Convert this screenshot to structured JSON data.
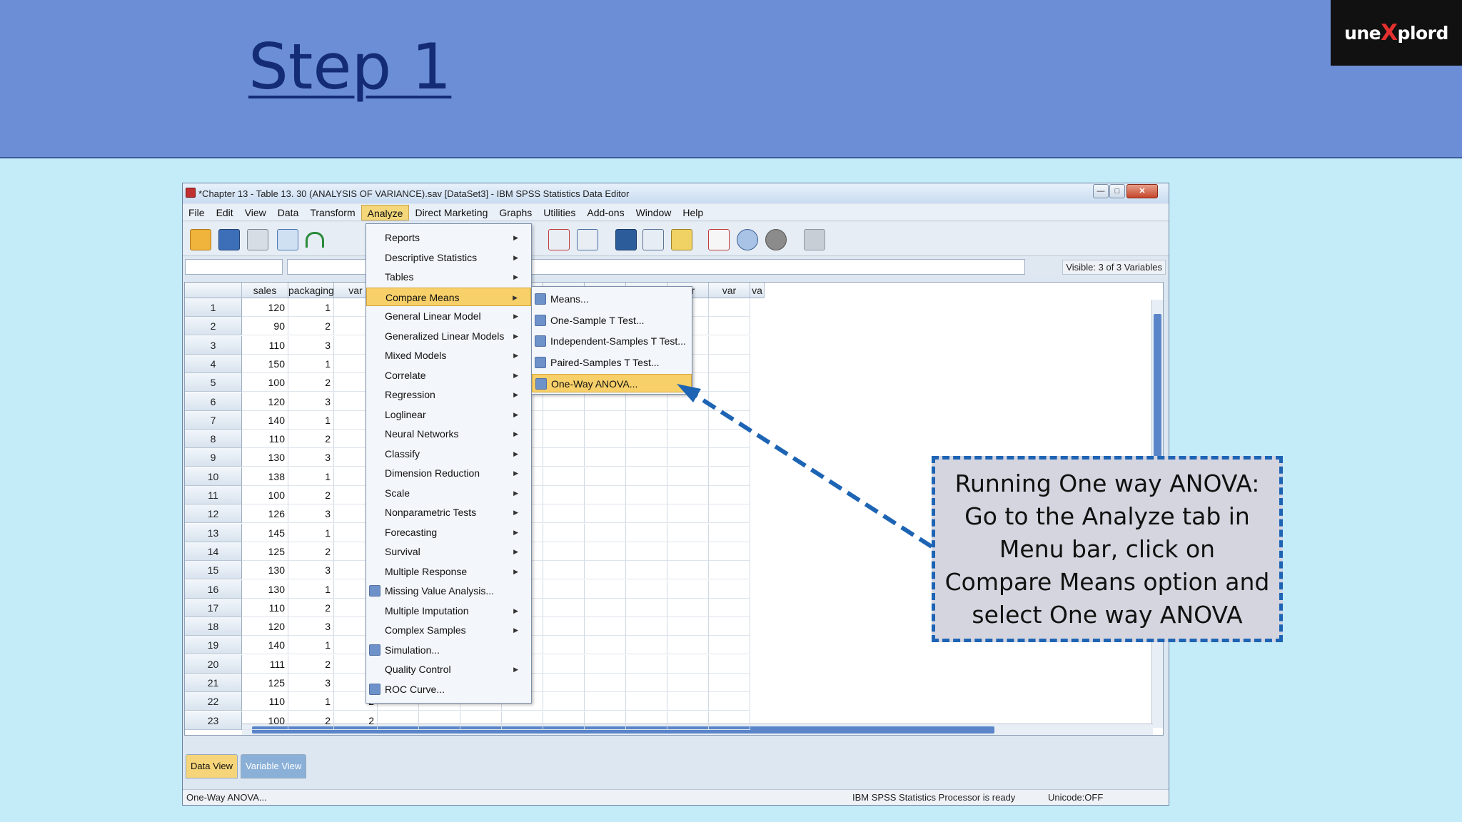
{
  "slide": {
    "title": "Step 1",
    "logo": {
      "pre": "une",
      "x": "X",
      "post": "plord"
    }
  },
  "window": {
    "title": "*Chapter 13 - Table 13. 30 (ANALYSIS OF VARIANCE).sav [DataSet3] - IBM SPSS Statistics Data Editor",
    "controls": [
      "min",
      "max",
      "close"
    ]
  },
  "menubar": [
    "File",
    "Edit",
    "View",
    "Data",
    "Transform",
    "Analyze",
    "Direct Marketing",
    "Graphs",
    "Utilities",
    "Add-ons",
    "Window",
    "Help"
  ],
  "menubar_active": "Analyze",
  "visible_vars": "Visible: 3 of 3 Variables",
  "columns": [
    "sales",
    "packaging",
    "var",
    "var",
    "var",
    "var",
    "var",
    "var",
    "var",
    "var",
    "var",
    "var",
    "va"
  ],
  "rows": [
    {
      "n": "1",
      "sales": "120",
      "packaging": "1"
    },
    {
      "n": "2",
      "sales": "90",
      "packaging": "2"
    },
    {
      "n": "3",
      "sales": "110",
      "packaging": "3"
    },
    {
      "n": "4",
      "sales": "150",
      "packaging": "1"
    },
    {
      "n": "5",
      "sales": "100",
      "packaging": "2"
    },
    {
      "n": "6",
      "sales": "120",
      "packaging": "3"
    },
    {
      "n": "7",
      "sales": "140",
      "packaging": "1"
    },
    {
      "n": "8",
      "sales": "110",
      "packaging": "2"
    },
    {
      "n": "9",
      "sales": "130",
      "packaging": "3"
    },
    {
      "n": "10",
      "sales": "138",
      "packaging": "1"
    },
    {
      "n": "11",
      "sales": "100",
      "packaging": "2"
    },
    {
      "n": "12",
      "sales": "126",
      "packaging": "3"
    },
    {
      "n": "13",
      "sales": "145",
      "packaging": "1"
    },
    {
      "n": "14",
      "sales": "125",
      "packaging": "2"
    },
    {
      "n": "15",
      "sales": "130",
      "packaging": "3"
    },
    {
      "n": "16",
      "sales": "130",
      "packaging": "1"
    },
    {
      "n": "17",
      "sales": "110",
      "packaging": "2"
    },
    {
      "n": "18",
      "sales": "120",
      "packaging": "3"
    },
    {
      "n": "19",
      "sales": "140",
      "packaging": "1"
    },
    {
      "n": "20",
      "sales": "111",
      "packaging": "2"
    },
    {
      "n": "21",
      "sales": "125",
      "packaging": "3"
    },
    {
      "n": "22",
      "sales": "110",
      "packaging": "1",
      "third": "2"
    },
    {
      "n": "23",
      "sales": "100",
      "packaging": "2",
      "third": "2"
    }
  ],
  "analyze_menu": [
    {
      "label": "Reports",
      "sub": true
    },
    {
      "label": "Descriptive Statistics",
      "sub": true
    },
    {
      "label": "Tables",
      "sub": true
    },
    {
      "label": "Compare Means",
      "sub": true,
      "selected": true
    },
    {
      "label": "General Linear Model",
      "sub": true
    },
    {
      "label": "Generalized Linear Models",
      "sub": true
    },
    {
      "label": "Mixed Models",
      "sub": true
    },
    {
      "label": "Correlate",
      "sub": true
    },
    {
      "label": "Regression",
      "sub": true
    },
    {
      "label": "Loglinear",
      "sub": true
    },
    {
      "label": "Neural Networks",
      "sub": true
    },
    {
      "label": "Classify",
      "sub": true
    },
    {
      "label": "Dimension Reduction",
      "sub": true
    },
    {
      "label": "Scale",
      "sub": true
    },
    {
      "label": "Nonparametric Tests",
      "sub": true
    },
    {
      "label": "Forecasting",
      "sub": true
    },
    {
      "label": "Survival",
      "sub": true
    },
    {
      "label": "Multiple Response",
      "sub": true
    },
    {
      "label": "Missing Value Analysis...",
      "icon": true
    },
    {
      "label": "Multiple Imputation",
      "sub": true
    },
    {
      "label": "Complex Samples",
      "sub": true
    },
    {
      "label": "Simulation...",
      "icon": true
    },
    {
      "label": "Quality Control",
      "sub": true
    },
    {
      "label": "ROC Curve...",
      "icon": true
    }
  ],
  "compare_means_menu": [
    {
      "label": "Means..."
    },
    {
      "label": "One-Sample T Test..."
    },
    {
      "label": "Independent-Samples T Test..."
    },
    {
      "label": "Paired-Samples T Test..."
    },
    {
      "label": "One-Way ANOVA...",
      "selected": true
    }
  ],
  "tabs": [
    "Data View",
    "Variable View"
  ],
  "status": {
    "left": "One-Way ANOVA...",
    "processor": "IBM SPSS Statistics Processor is ready",
    "unicode": "Unicode:OFF"
  },
  "callout": "Running One way ANOVA: Go to the Analyze tab in Menu bar, click on Compare Means option and select One way ANOVA",
  "colors": {
    "banner": "#6b8ed6",
    "title": "#142b75",
    "callout_border": "#1e64b4",
    "highlight": "#f7d069"
  }
}
